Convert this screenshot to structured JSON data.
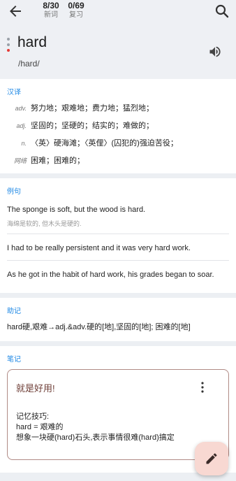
{
  "counters": {
    "new": {
      "value": "8/30",
      "label": "新词"
    },
    "review": {
      "value": "0/69",
      "label": "复习"
    }
  },
  "word": {
    "text": "hard",
    "phonetic": "/hard/"
  },
  "translation": {
    "title": "汉译",
    "items": [
      {
        "pos": "adv.",
        "text": "努力地；艰难地；费力地；猛烈地；"
      },
      {
        "pos": "adj.",
        "text": "坚固的；坚硬的；结实的；难做的；"
      },
      {
        "pos": "n.",
        "text": "〈英〉硬海滩；〈英俚〉(囚犯的)强迫苦役；"
      },
      {
        "pos": "网络",
        "text": "困难；困难的；"
      }
    ]
  },
  "examples": {
    "title": "例句",
    "items": [
      {
        "en": "The sponge is soft, but the wood is hard.",
        "zh": "海绵是软的, 但木头是硬的."
      },
      {
        "en": "I had to be really persistent and it was very hard work.",
        "zh": ""
      },
      {
        "en": "As he got in the habit of hard work, his grades began to soar.",
        "zh": ""
      }
    ]
  },
  "mnemonic": {
    "title": "助记",
    "text": "hard硬,艰难→adj.&adv.硬的[地],坚固的[地]; 困难的[地]"
  },
  "notes": {
    "title": "笔记",
    "card_title": "就是好用!",
    "lines": [
      "记忆技巧:",
      "hard = 艰难的",
      "想象一块硬(hard)石头,表示事情很难(hard)搞定"
    ]
  },
  "colors": {
    "accent": "#1e88e5",
    "note_title": "#6d3c35",
    "fab": "#f8d8d2"
  },
  "icons": [
    "back-arrow-icon",
    "search-icon",
    "speaker-icon",
    "more-vert-icon",
    "edit-pencil-icon"
  ]
}
